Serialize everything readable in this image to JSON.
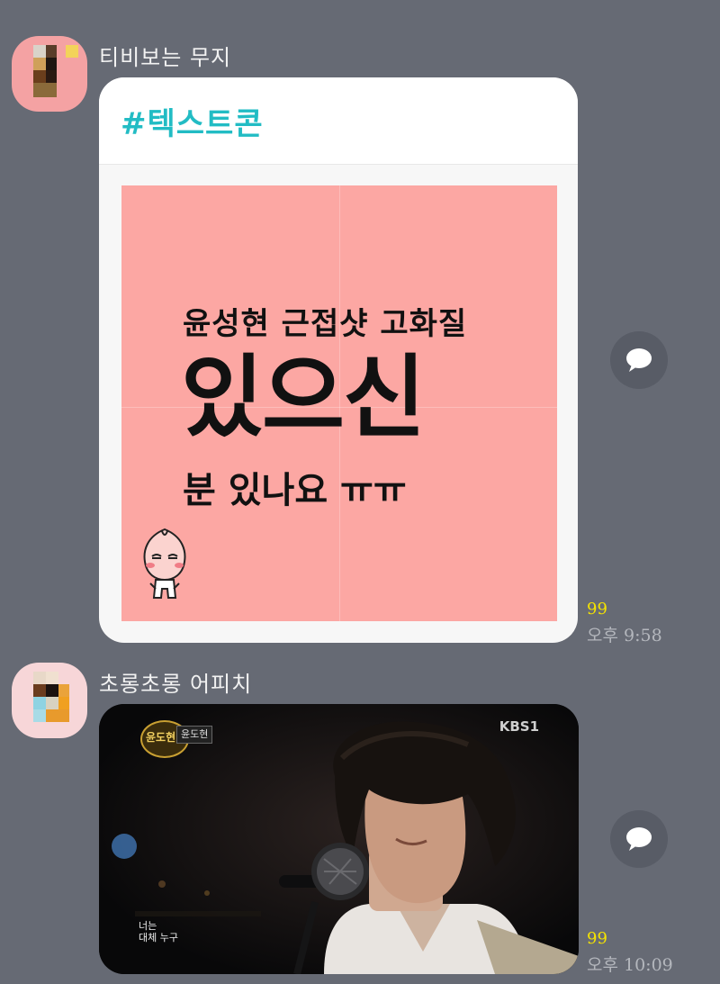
{
  "messages": [
    {
      "sender": "티비보는 무지",
      "avatar_icon": "blurred-avatar-icon",
      "card": {
        "tag": "#텍스트콘",
        "sticker_line1": "윤성현 근접샷 고화질",
        "sticker_line2": "있으신",
        "sticker_line3": "분 있나요 ㅠㅠ",
        "sticker_color": "#fca7a3"
      },
      "reaction_count": "99",
      "time": "오후 9:58"
    },
    {
      "sender": "초롱초롱 어피치",
      "avatar_icon": "blurred-avatar-icon",
      "video": {
        "show_logo": "윤도현",
        "sub_tag": "윤도현",
        "channel": "KBS1",
        "caption_line1": "너는",
        "caption_line2": "대체 누구"
      },
      "reaction_count": "99",
      "time": "오후 10:09"
    }
  ],
  "colors": {
    "background": "#666a74",
    "count_color": "#f5e300",
    "tag_color": "#22bcc4"
  },
  "icons": {
    "share": "speech-bubble-icon"
  }
}
